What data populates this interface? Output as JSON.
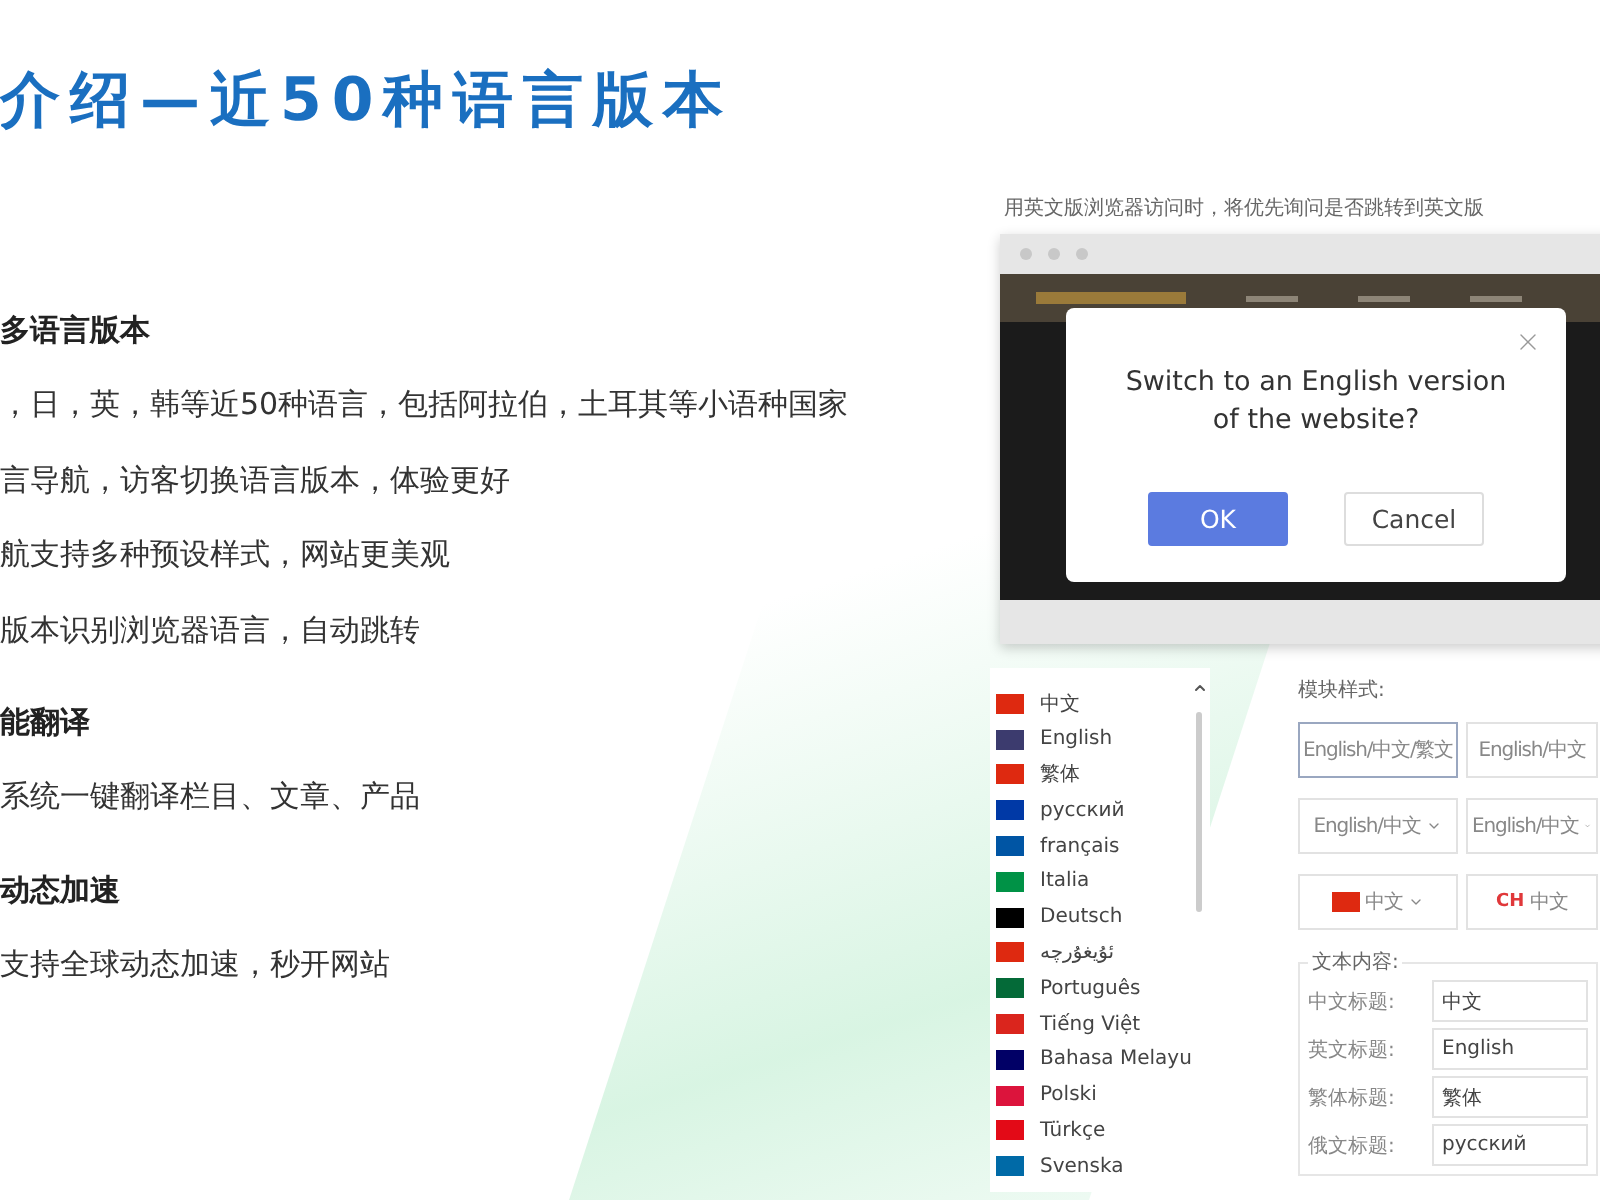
{
  "title": "介绍—近50种语言版本",
  "sections": [
    {
      "heading": "多语言版本",
      "lines": [
        "，日，英，韩等近50种语言，包括阿拉伯，土耳其等小语种国家",
        "言导航，访客切换语言版本，体验更好",
        "航支持多种预设样式，网站更美观",
        "版本识别浏览器语言，自动跳转"
      ]
    },
    {
      "heading": "能翻译",
      "lines": [
        "系统一键翻译栏目、文章、产品"
      ]
    },
    {
      "heading": "动态加速",
      "lines": [
        "支持全球动态加速，秒开网站"
      ]
    }
  ],
  "preview": {
    "caption": "用英文版浏览器访问时，将优先询问是否跳转到英文版",
    "dialog": {
      "message": "Switch to an English version of the website?",
      "buttons": [
        {
          "label": "OK",
          "primary": true
        },
        {
          "label": "Cancel",
          "primary": false
        }
      ]
    }
  },
  "language_list": {
    "items": [
      {
        "label": "中文",
        "color": "#de2910"
      },
      {
        "label": "English",
        "color": "#3c3b6e"
      },
      {
        "label": "繁体",
        "color": "#de2910"
      },
      {
        "label": "русский",
        "color": "#0039a6"
      },
      {
        "label": "français",
        "color": "#0055a4"
      },
      {
        "label": "Italia",
        "color": "#009246"
      },
      {
        "label": "Deutsch",
        "color": "#000000"
      },
      {
        "label": "ئۇيغۇرچە",
        "color": "#de2910"
      },
      {
        "label": "Português",
        "color": "#046a38"
      },
      {
        "label": "Tiếng Việt",
        "color": "#da251d"
      },
      {
        "label": "Bahasa Melayu",
        "color": "#010066"
      },
      {
        "label": "Polski",
        "color": "#dc143c"
      },
      {
        "label": "Türkçe",
        "color": "#e30a17"
      },
      {
        "label": "Svenska",
        "color": "#006aa7"
      }
    ]
  },
  "style_panel": {
    "label": "模块样式:",
    "options": [
      {
        "kind": "text",
        "label": "English/中文/繁文",
        "selected": true
      },
      {
        "kind": "text",
        "label": "English/中文",
        "selected": false
      },
      {
        "kind": "dropdown",
        "label": "English/中文",
        "selected": false
      },
      {
        "kind": "dropdown",
        "label": "English/中文",
        "selected": false
      },
      {
        "kind": "flag",
        "label": "中文",
        "selected": false
      },
      {
        "kind": "code",
        "code": "CH",
        "label": "中文",
        "selected": false
      }
    ],
    "text_content": {
      "legend": "文本内容:",
      "fields": [
        {
          "label": "中文标题:",
          "value": "中文"
        },
        {
          "label": "英文标题:",
          "value": "English"
        },
        {
          "label": "繁体标题:",
          "value": "繁体"
        },
        {
          "label": "俄文标题:",
          "value": "русский"
        }
      ]
    }
  }
}
